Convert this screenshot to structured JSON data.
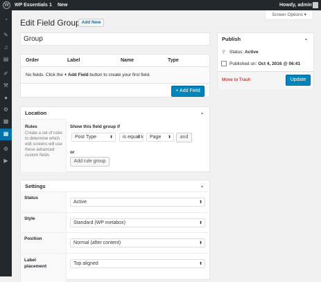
{
  "adminbar": {
    "site": "WP Essentials",
    "updates": "1",
    "new": "New",
    "howdy": "Howdy, admin"
  },
  "screen_options": "Screen Options ▾",
  "page_title": "Edit Field Group",
  "add_new": "Add New",
  "title_value": "Group",
  "fields": {
    "columns": [
      "Order",
      "Label",
      "Name",
      "Type"
    ],
    "empty_pre": "No fields. Click the ",
    "empty_bold": "+ Add Field",
    "empty_post": " button to create your first field.",
    "add_field": "+ Add Field"
  },
  "location": {
    "title": "Location",
    "rules_label": "Rules",
    "rules_desc": "Create a set of rules to determine which edit screens will use these advanced custom fields",
    "show_if": "Show this field group if",
    "param": "Post Type",
    "operator": "is equal to",
    "value": "Page",
    "and": "and",
    "or": "or",
    "add_rule_group": "Add rule group"
  },
  "settings": {
    "title": "Settings",
    "rows": [
      {
        "label": "Status",
        "value": "Active"
      },
      {
        "label": "Style",
        "value": "Standard (WP metabox)"
      },
      {
        "label": "Position",
        "value": "Normal (after content)"
      },
      {
        "label": "Label placement",
        "value": "Top aligned"
      }
    ]
  },
  "publish": {
    "title": "Publish",
    "status_label": "Status: ",
    "status_value": "Active",
    "published_label": "Published on: ",
    "published_value": "Oct 4, 2016 @ 06:41",
    "trash": "Move to Trash",
    "update": "Update"
  },
  "colors": {
    "primary": "#0085ba",
    "trash": "#a00",
    "adminbar": "#23282d"
  }
}
